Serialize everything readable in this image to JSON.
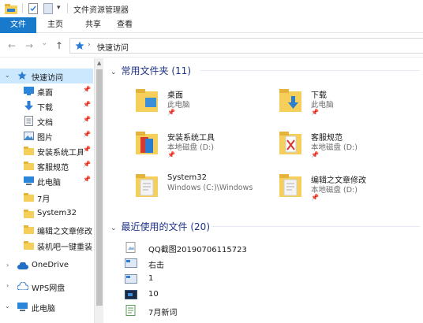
{
  "window": {
    "title": "文件资源管理器"
  },
  "ribbon": {
    "tabs": [
      "文件",
      "主页",
      "共享",
      "查看"
    ],
    "active_tab": "文件"
  },
  "address": {
    "crumb": "快速访问",
    "back": "←",
    "forward": "→",
    "dropdown": "⌄",
    "up": "↑",
    "chevron": "›"
  },
  "nav": {
    "quick_access": "快速访问",
    "items": [
      {
        "label": "桌面",
        "pinned": true
      },
      {
        "label": "下载",
        "pinned": true
      },
      {
        "label": "文档",
        "pinned": true
      },
      {
        "label": "图片",
        "pinned": true
      },
      {
        "label": "安装系统工具",
        "pinned": true
      },
      {
        "label": "客服规范",
        "pinned": true
      },
      {
        "label": "此电脑",
        "pinned": true
      },
      {
        "label": "7月",
        "pinned": false
      },
      {
        "label": "System32",
        "pinned": false
      },
      {
        "label": "编辑之文章修改",
        "pinned": false
      },
      {
        "label": "装机吧一键重装",
        "pinned": false
      }
    ],
    "onedrive": "OneDrive",
    "wps": "WPS网盘",
    "this_pc": "此电脑",
    "pin_glyph": "📌"
  },
  "content": {
    "frequent_header": "常用文件夹 (11)",
    "recent_header": "最近使用的文件 (20)",
    "folders": [
      {
        "name": "桌面",
        "sub": "此电脑",
        "icon": "desktop-folder-icon"
      },
      {
        "name": "下载",
        "sub": "此电脑",
        "icon": "downloads-folder-icon"
      },
      {
        "name": "安装系统工具",
        "sub": "本地磁盘 (D:)",
        "icon": "tools-folder-icon"
      },
      {
        "name": "客服规范",
        "sub": "本地磁盘 (D:)",
        "icon": "pdf-folder-icon"
      },
      {
        "name": "System32",
        "sub": "Windows (C:)\\Windows",
        "icon": "system-folder-icon"
      },
      {
        "name": "编辑之文章修改",
        "sub": "本地磁盘 (D:)",
        "icon": "documents-folder-icon"
      }
    ],
    "recent_files": [
      {
        "name": "QQ截图20190706115723",
        "icon": "image-file-icon"
      },
      {
        "name": "右击",
        "icon": "screenshot-file-icon"
      },
      {
        "name": "1",
        "icon": "screenshot-file-icon"
      },
      {
        "name": "10",
        "icon": "dark-screenshot-file-icon"
      },
      {
        "name": "7月新词",
        "icon": "text-file-icon"
      }
    ]
  },
  "colors": {
    "accent": "#1979ca",
    "selection": "#cce8ff",
    "header": "#1e3287",
    "folder": "#f6cf5a"
  }
}
